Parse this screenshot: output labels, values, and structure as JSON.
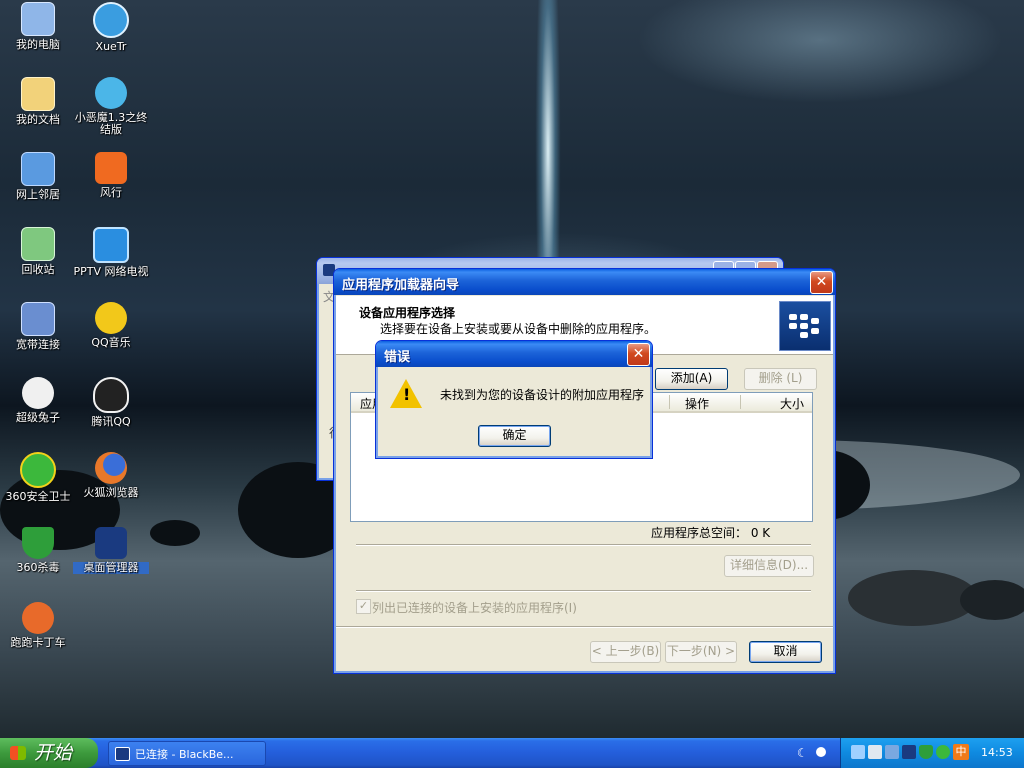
{
  "desktop": {
    "icons": [
      {
        "label": "我的电脑",
        "icon": "my-computer-icon",
        "color": "#8fb6e8"
      },
      {
        "label": "XueTr",
        "icon": "xuetr-icon",
        "color": "#3a9de0"
      },
      {
        "label": "我的文档",
        "icon": "my-documents-icon",
        "color": "#f2d27a"
      },
      {
        "label": "小恶魔1.3之终结版",
        "icon": "little-devil-icon",
        "color": "#4bb6e8"
      },
      {
        "label": "网上邻居",
        "icon": "network-places-icon",
        "color": "#5a9ae0"
      },
      {
        "label": "风行",
        "icon": "funshion-icon",
        "color": "#f06a20"
      },
      {
        "label": "回收站",
        "icon": "recycle-bin-icon",
        "color": "#7fc87f"
      },
      {
        "label": "PPTV 网络电视",
        "icon": "pptv-icon",
        "color": "#2a8ee0"
      },
      {
        "label": "宽带连接",
        "icon": "broadband-connection-icon",
        "color": "#6a8ed0"
      },
      {
        "label": "QQ音乐",
        "icon": "qq-music-icon",
        "color": "#f2c81a"
      },
      {
        "label": "超级兔子",
        "icon": "super-rabbit-icon",
        "color": "#f0f0f0"
      },
      {
        "label": "腾讯QQ",
        "icon": "tencent-qq-icon",
        "color": "#222222"
      },
      {
        "label": "360安全卫士",
        "icon": "360-safeguard-icon",
        "color": "#3cb83c"
      },
      {
        "label": "火狐浏览器",
        "icon": "firefox-icon",
        "color": "#e8782a"
      },
      {
        "label": "360杀毒",
        "icon": "360-antivirus-icon",
        "color": "#2e9e3a"
      },
      {
        "label": "桌面管理器",
        "icon": "desktop-manager-icon",
        "color": "#1a3a80"
      },
      {
        "label": "跑跑卡丁车",
        "icon": "kartrider-icon",
        "color": "#e86a2a"
      }
    ]
  },
  "wizard": {
    "title": "应用程序加载器向导",
    "header_title": "设备应用程序选择",
    "header_subtitle": "选择要在设备上安装或要从设备中删除的应用程序。",
    "add_button": "添加(A)",
    "delete_button": "删除 (L)",
    "columns": [
      "应用程序",
      "操作",
      "大小"
    ],
    "total_space_label": "应用程序总空间：  0 K",
    "details_button": "详细信息(D)...",
    "list_connected_checkbox": "列出已连接的设备上安装的应用程序(I)",
    "back_button": "< 上一步(B)",
    "next_button": "下一步(N) >",
    "cancel_button": "取消"
  },
  "error_dialog": {
    "title": "错误",
    "message": "未找到为您的设备设计的附加应用程序",
    "ok_button": "确定"
  },
  "background_window": {
    "partial_text_1": "文",
    "partial_text_2": "行"
  },
  "taskbar": {
    "start_label": "开始",
    "task_label": "已连接 - BlackBe...",
    "clock": "14:53",
    "ime_label": "中"
  },
  "colors": {
    "xp_blue": "#0a4dcc",
    "dialog_face": "#ece9d8",
    "close_red": "#d1491f",
    "warning_yellow": "#f2c200"
  }
}
